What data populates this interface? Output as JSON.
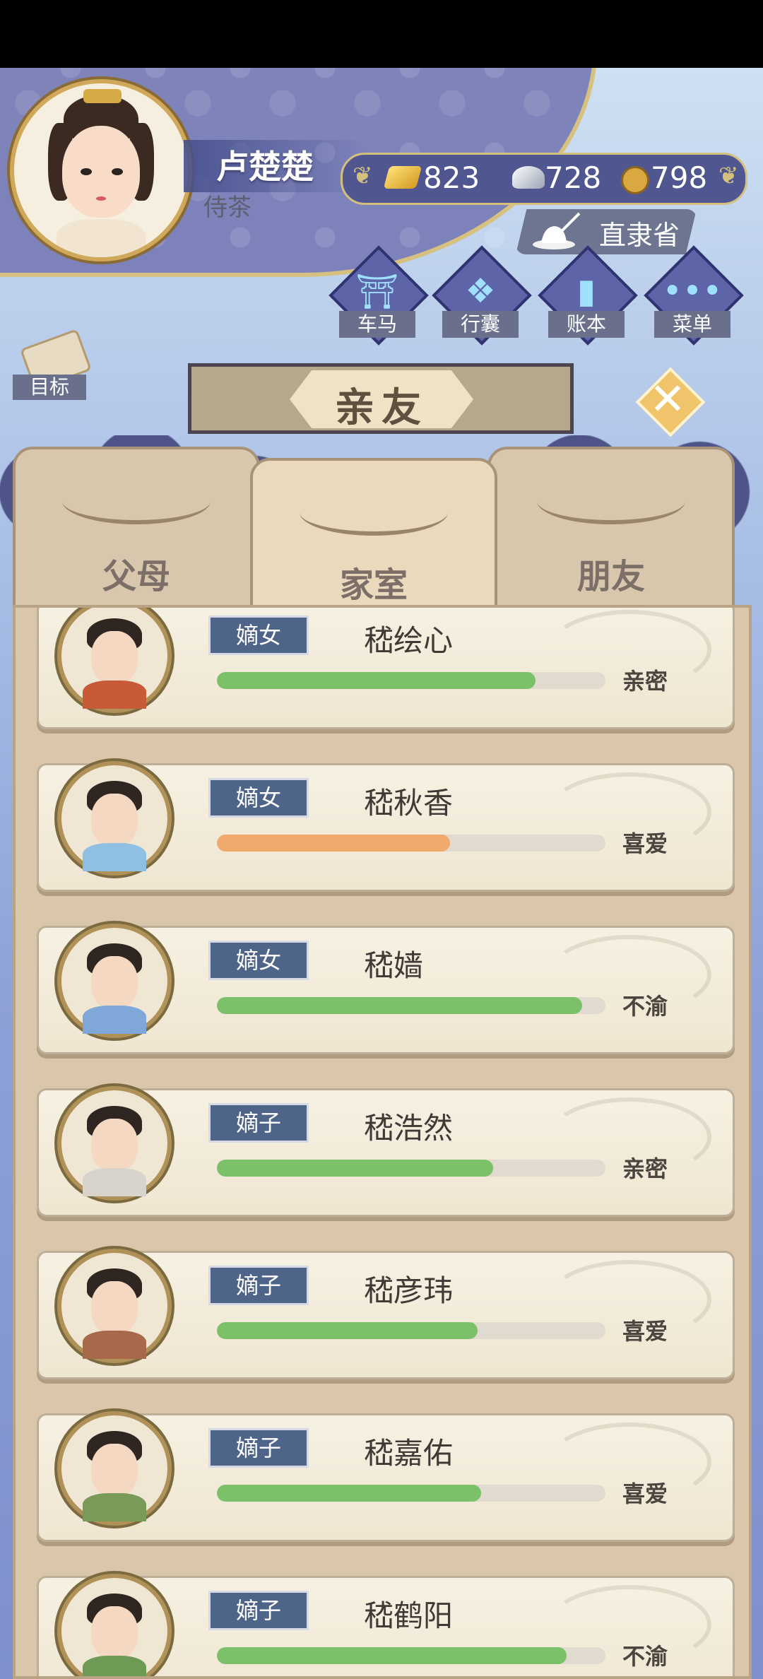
{
  "player": {
    "name": "卢楚楚",
    "title": "侍茶"
  },
  "currency": {
    "gold": "823",
    "silver": "728",
    "coin": "798"
  },
  "region": {
    "label": "直隶省"
  },
  "nav": [
    {
      "label": "车马",
      "icon": "carriage-icon"
    },
    {
      "label": "行囊",
      "icon": "bundle-icon"
    },
    {
      "label": "账本",
      "icon": "ledger-icon"
    },
    {
      "label": "菜单",
      "icon": "more-icon"
    }
  ],
  "goal": {
    "label": "目标"
  },
  "title": "亲友",
  "tabs": {
    "parents": "父母",
    "family": "家室",
    "friends": "朋友"
  },
  "members": [
    {
      "role": "嫡女",
      "name": "嵇绘心",
      "relation": "亲密",
      "level": 0.82,
      "bar_color": "#7cc06a",
      "cloth": "#c75b38"
    },
    {
      "role": "嫡女",
      "name": "嵇秋香",
      "relation": "喜爱",
      "level": 0.6,
      "bar_color": "#efaa6c",
      "cloth": "#8fc0e3"
    },
    {
      "role": "嫡女",
      "name": "嵇嫱",
      "relation": "不渝",
      "level": 0.94,
      "bar_color": "#7cc06a",
      "cloth": "#7fa7d8"
    },
    {
      "role": "嫡子",
      "name": "嵇浩然",
      "relation": "亲密",
      "level": 0.71,
      "bar_color": "#7cc06a",
      "cloth": "#d8d4cc"
    },
    {
      "role": "嫡子",
      "name": "嵇彦玮",
      "relation": "喜爱",
      "level": 0.67,
      "bar_color": "#7cc06a",
      "cloth": "#a8684a"
    },
    {
      "role": "嫡子",
      "name": "嵇嘉佑",
      "relation": "喜爱",
      "level": 0.68,
      "bar_color": "#7cc06a",
      "cloth": "#7a9a5a"
    },
    {
      "role": "嫡子",
      "name": "嵇鹤阳",
      "relation": "不渝",
      "level": 0.9,
      "bar_color": "#7cc06a",
      "cloth": "#6f9a56"
    }
  ]
}
